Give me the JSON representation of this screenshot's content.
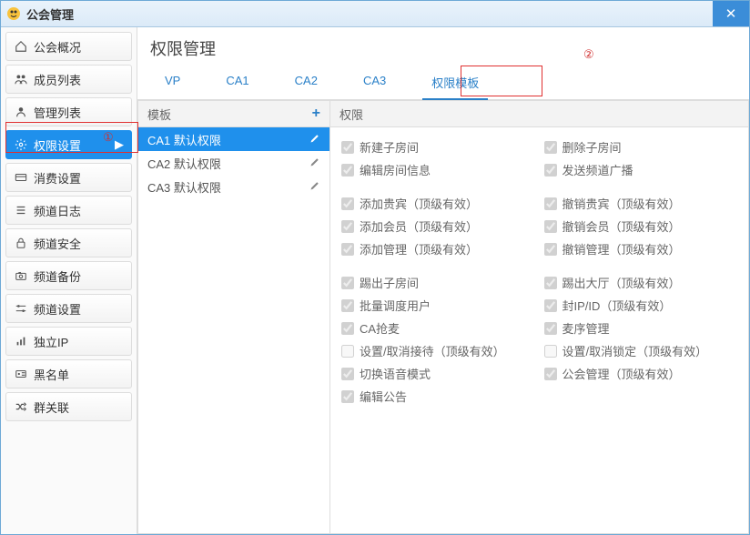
{
  "window": {
    "title": "公会管理"
  },
  "annotations": {
    "a1": "①",
    "a2": "②"
  },
  "sidebar": {
    "items": [
      {
        "label": "公会概况",
        "icon": "home"
      },
      {
        "label": "成员列表",
        "icon": "users"
      },
      {
        "label": "管理列表",
        "icon": "user"
      },
      {
        "label": "权限设置",
        "icon": "gear",
        "active": true
      },
      {
        "label": "消费设置",
        "icon": "card"
      },
      {
        "label": "频道日志",
        "icon": "list"
      },
      {
        "label": "频道安全",
        "icon": "lock"
      },
      {
        "label": "频道备份",
        "icon": "camera"
      },
      {
        "label": "频道设置",
        "icon": "sliders"
      },
      {
        "label": "独立IP",
        "icon": "bars"
      },
      {
        "label": "黑名单",
        "icon": "idcard"
      },
      {
        "label": "群关联",
        "icon": "shuffle"
      }
    ]
  },
  "page": {
    "title": "权限管理"
  },
  "tabs": [
    {
      "label": "VP"
    },
    {
      "label": "CA1"
    },
    {
      "label": "CA2"
    },
    {
      "label": "CA3"
    },
    {
      "label": "权限模板",
      "active": true
    }
  ],
  "templates": {
    "header": "模板",
    "items": [
      {
        "label": "CA1 默认权限",
        "active": true
      },
      {
        "label": "CA2 默认权限"
      },
      {
        "label": "CA3 默认权限"
      }
    ]
  },
  "permissions": {
    "header": "权限",
    "groups": [
      [
        {
          "label": "新建子房间",
          "checked": true
        },
        {
          "label": "删除子房间",
          "checked": true
        },
        {
          "label": "编辑房间信息",
          "checked": true
        },
        {
          "label": "发送频道广播",
          "checked": true
        }
      ],
      [
        {
          "label": "添加贵宾（顶级有效）",
          "checked": true
        },
        {
          "label": "撤销贵宾（顶级有效）",
          "checked": true
        },
        {
          "label": "添加会员（顶级有效）",
          "checked": true
        },
        {
          "label": "撤销会员（顶级有效）",
          "checked": true
        },
        {
          "label": "添加管理（顶级有效）",
          "checked": true
        },
        {
          "label": "撤销管理（顶级有效）",
          "checked": true
        }
      ],
      [
        {
          "label": "踢出子房间",
          "checked": true
        },
        {
          "label": "踢出大厅（顶级有效）",
          "checked": true
        },
        {
          "label": "批量调度用户",
          "checked": true
        },
        {
          "label": "封IP/ID（顶级有效）",
          "checked": true
        },
        {
          "label": "CA抢麦",
          "checked": true
        },
        {
          "label": "麦序管理",
          "checked": true
        },
        {
          "label": "设置/取消接待（顶级有效）",
          "checked": false
        },
        {
          "label": "设置/取消锁定（顶级有效）",
          "checked": false
        },
        {
          "label": "切换语音模式",
          "checked": true
        },
        {
          "label": "公会管理（顶级有效）",
          "checked": true
        },
        {
          "label": "编辑公告",
          "checked": true
        }
      ]
    ]
  }
}
